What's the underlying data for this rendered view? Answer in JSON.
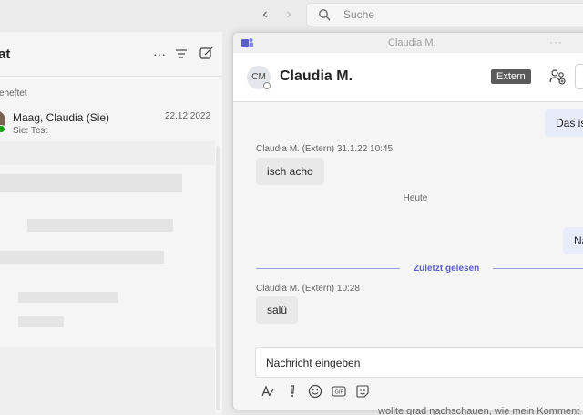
{
  "topbar": {
    "back": "‹",
    "forward": "›",
    "search_placeholder": "Suche"
  },
  "chat_list": {
    "title": "at",
    "more": "···",
    "pinned_label": "eheftet",
    "pinned_item": {
      "name": "Maag, Claudia (Sie)",
      "date": "22.12.2022",
      "preview": "Sie: Test"
    }
  },
  "window": {
    "title": "Claudia M.",
    "more": "···"
  },
  "header": {
    "initials": "CM",
    "name": "Claudia M.",
    "badge": "Extern"
  },
  "messages": {
    "out_top": "Das ist",
    "msg1_meta": "Claudia M. (Extern)   31.1.22 10:45",
    "msg1_text": "isch acho",
    "day_separator": "Heute",
    "out_mid": "Na",
    "read_marker": "Zuletzt gelesen",
    "msg2_meta": "Claudia M. (Extern)   10:28",
    "msg2_text": "salü"
  },
  "composer": {
    "placeholder": "Nachricht eingeben"
  },
  "background_text": "wollte grad nachschauen, wie mein Komment"
}
